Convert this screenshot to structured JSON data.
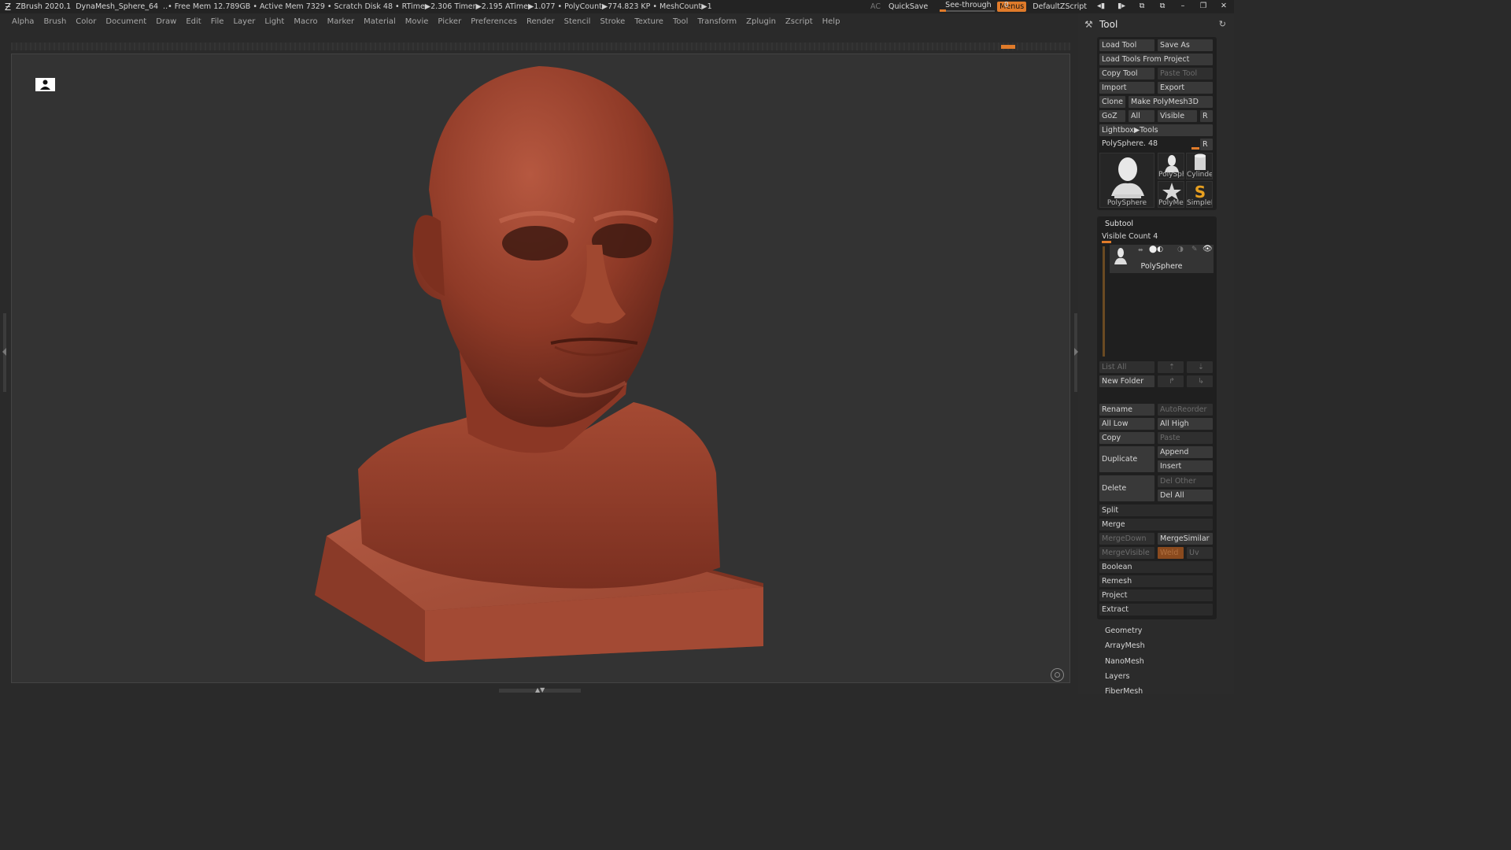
{
  "titlebar": {
    "app": "ZBrush 2020.1",
    "doc": "DynaMesh_Sphere_64",
    "stats": "..• Free Mem 12.789GB • Active Mem 7329 • Scratch Disk 48 • RTime▶2.306 Timer▶2.195 ATime▶1.077 • PolyCount▶774.823 KP • MeshCount▶1",
    "ac": "AC",
    "quicksave": "QuickSave",
    "seethrough_label": "See-through",
    "seethrough_value": "0",
    "menus": "Menus",
    "script": "DefaultZScript"
  },
  "menubar": [
    "Alpha",
    "Brush",
    "Color",
    "Document",
    "Draw",
    "Edit",
    "File",
    "Layer",
    "Light",
    "Macro",
    "Marker",
    "Material",
    "Movie",
    "Picker",
    "Preferences",
    "Render",
    "Stencil",
    "Stroke",
    "Texture",
    "Tool",
    "Transform",
    "Zplugin",
    "Zscript",
    "Help"
  ],
  "tool": {
    "title": "Tool",
    "load_tool": "Load Tool",
    "save_as": "Save As",
    "load_from_project": "Load Tools From Project",
    "copy_tool": "Copy Tool",
    "paste_tool": "Paste Tool",
    "import": "Import",
    "export": "Export",
    "clone": "Clone",
    "make_polymesh": "Make PolyMesh3D",
    "goz": "GoZ",
    "all": "All",
    "visible": "Visible",
    "r": "R",
    "lightbox": "Lightbox▶Tools",
    "current_tool": "PolySphere. 48",
    "thumbs": [
      "PolySphere",
      "PolySph",
      "Cylinder",
      "PolyMes",
      "SimpleB"
    ]
  },
  "subtool": {
    "title": "Subtool",
    "visible_count": "Visible Count 4",
    "item_name": "PolySphere",
    "list_all": "List All",
    "new_folder": "New Folder",
    "rename": "Rename",
    "autoreorder": "AutoReorder",
    "all_low": "All Low",
    "all_high": "All High",
    "copy": "Copy",
    "paste": "Paste",
    "duplicate": "Duplicate",
    "append": "Append",
    "insert": "Insert",
    "delete": "Delete",
    "del_other": "Del Other",
    "del_all": "Del All",
    "split": "Split",
    "merge": "Merge",
    "merge_down": "MergeDown",
    "merge_similar": "MergeSimilar",
    "merge_visible": "MergeVisible",
    "weld": "Weld",
    "uv": "Uv",
    "boolean": "Boolean",
    "remesh": "Remesh",
    "project": "Project",
    "extract": "Extract"
  },
  "footer_menus": [
    "Geometry",
    "ArrayMesh",
    "NanoMesh",
    "Layers",
    "FiberMesh"
  ],
  "colors": {
    "accent": "#e07b2a",
    "clay": "#a8452f"
  }
}
